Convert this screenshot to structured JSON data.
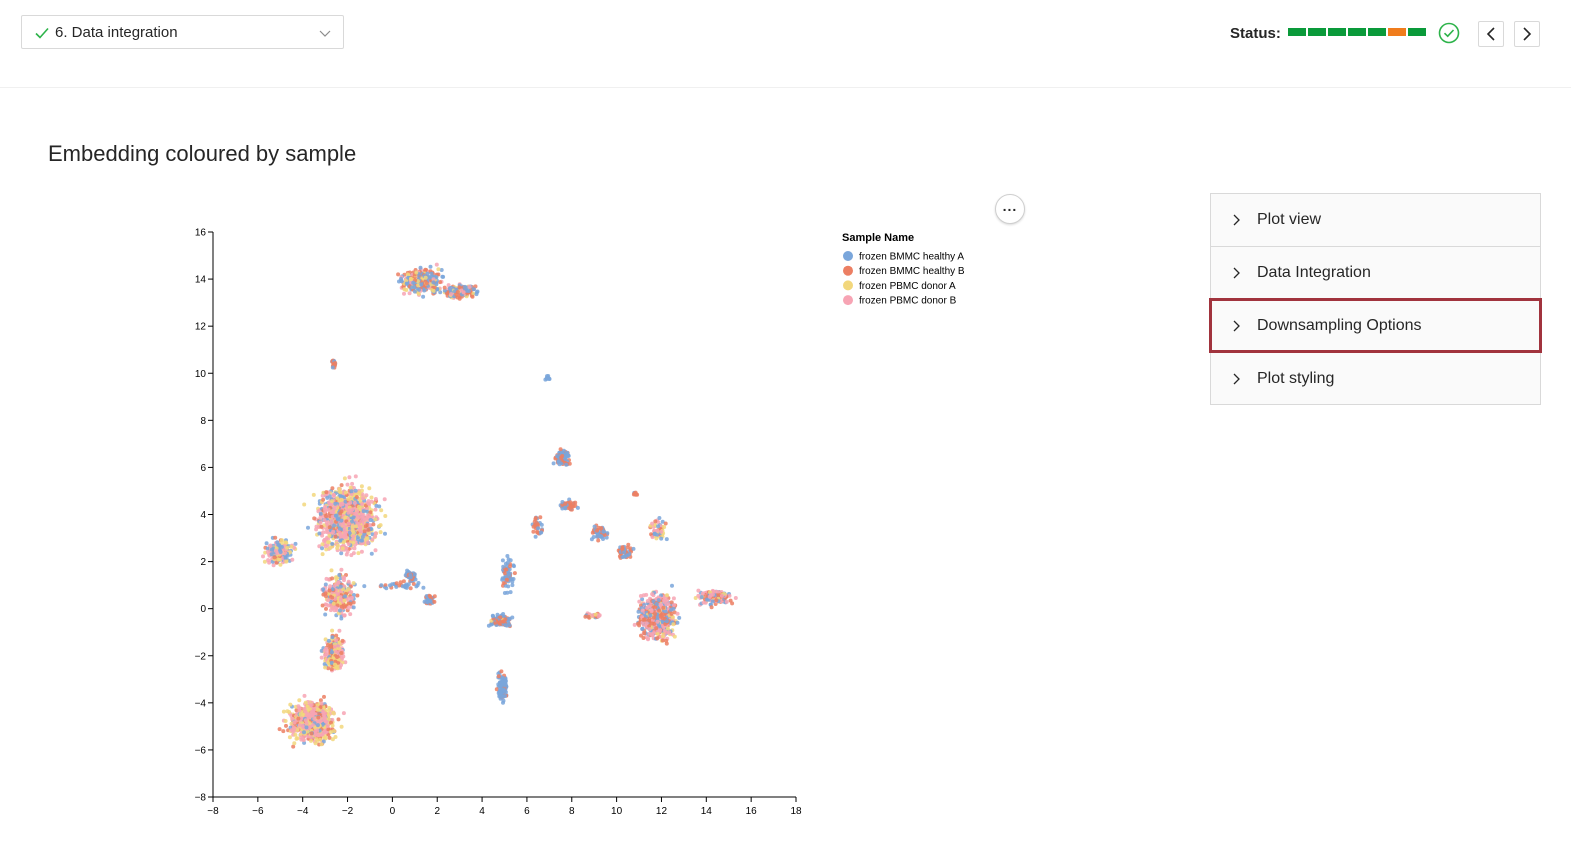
{
  "header": {
    "step_select": {
      "value": "6. Data integration"
    },
    "status": {
      "label": "Status:",
      "steps": [
        "#0a9a3a",
        "#0a9a3a",
        "#0a9a3a",
        "#0a9a3a",
        "#0a9a3a",
        "#f07c1c",
        "#0a9a3a"
      ],
      "ok_color": "#2db34a"
    }
  },
  "main": {
    "title": "Embedding coloured by sample"
  },
  "side_panel": {
    "items": [
      {
        "label": "Plot view"
      },
      {
        "label": "Data Integration"
      },
      {
        "label": "Downsampling Options",
        "highlighted": true
      },
      {
        "label": "Plot styling"
      }
    ],
    "highlight_color": "#a1333d"
  },
  "chart_data": {
    "type": "scatter",
    "title": "",
    "xlabel": "",
    "ylabel": "",
    "xlim": [
      -8,
      18
    ],
    "ylim": [
      -8,
      16
    ],
    "xticks": [
      "−8",
      "−6",
      "−4",
      "−2",
      "0",
      "2",
      "4",
      "6",
      "8",
      "10",
      "12",
      "14",
      "16",
      "18"
    ],
    "yticks": [
      "16",
      "14",
      "12",
      "10",
      "8",
      "6",
      "4",
      "2",
      "0",
      "−2",
      "−4",
      "−6",
      "−8"
    ],
    "legend": {
      "title": "Sample Name",
      "placement": "right",
      "entries": [
        {
          "name": "frozen BMMC healthy A",
          "color": "#7aa6db"
        },
        {
          "name": "frozen BMMC healthy B",
          "color": "#ec7f63"
        },
        {
          "name": "frozen PBMC donor A",
          "color": "#f2d77c"
        },
        {
          "name": "frozen PBMC donor B",
          "color": "#f7a4b4"
        }
      ]
    },
    "clusters": [
      {
        "cx": -2.0,
        "cy": 3.8,
        "rx": 2.2,
        "ry": 2.2,
        "n": 1100,
        "weights": [
          0.2,
          0.1,
          0.3,
          0.4
        ]
      },
      {
        "cx": -5.0,
        "cy": 2.4,
        "rx": 1.0,
        "ry": 0.9,
        "n": 200,
        "weights": [
          0.35,
          0.1,
          0.25,
          0.3
        ]
      },
      {
        "cx": -2.4,
        "cy": 0.6,
        "rx": 1.1,
        "ry": 1.4,
        "n": 250,
        "weights": [
          0.15,
          0.2,
          0.25,
          0.4
        ]
      },
      {
        "cx": -2.6,
        "cy": -1.9,
        "rx": 0.8,
        "ry": 1.3,
        "n": 200,
        "weights": [
          0.1,
          0.25,
          0.25,
          0.4
        ]
      },
      {
        "cx": -3.6,
        "cy": -4.8,
        "rx": 1.7,
        "ry": 1.5,
        "n": 700,
        "weights": [
          0.1,
          0.15,
          0.3,
          0.45
        ]
      },
      {
        "cx": 1.3,
        "cy": 13.9,
        "rx": 1.5,
        "ry": 0.9,
        "n": 350,
        "weights": [
          0.35,
          0.35,
          0.15,
          0.15
        ]
      },
      {
        "cx": 3.0,
        "cy": 13.5,
        "rx": 1.2,
        "ry": 0.5,
        "n": 150,
        "weights": [
          0.35,
          0.45,
          0.1,
          0.1
        ]
      },
      {
        "cx": -2.6,
        "cy": 10.4,
        "rx": 0.15,
        "ry": 0.4,
        "n": 20,
        "weights": [
          0.5,
          0.5,
          0,
          0
        ]
      },
      {
        "cx": 6.9,
        "cy": 9.8,
        "rx": 0.2,
        "ry": 0.2,
        "n": 12,
        "weights": [
          0.9,
          0.1,
          0,
          0
        ]
      },
      {
        "cx": 0.8,
        "cy": 1.4,
        "rx": 0.4,
        "ry": 0.35,
        "n": 60,
        "weights": [
          0.8,
          0.2,
          0,
          0
        ]
      },
      {
        "cx": 1.7,
        "cy": 0.4,
        "rx": 0.4,
        "ry": 0.3,
        "n": 35,
        "weights": [
          0.6,
          0.4,
          0,
          0
        ]
      },
      {
        "cx": 4.8,
        "cy": -0.5,
        "rx": 0.8,
        "ry": 0.4,
        "n": 110,
        "weights": [
          0.6,
          0.35,
          0.05,
          0
        ]
      },
      {
        "cx": 5.1,
        "cy": 1.5,
        "rx": 0.5,
        "ry": 1.2,
        "n": 70,
        "weights": [
          0.6,
          0.4,
          0,
          0
        ]
      },
      {
        "cx": 6.5,
        "cy": 3.5,
        "rx": 0.4,
        "ry": 0.8,
        "n": 35,
        "weights": [
          0.5,
          0.5,
          0,
          0
        ]
      },
      {
        "cx": 4.9,
        "cy": -3.3,
        "rx": 0.35,
        "ry": 1.0,
        "n": 110,
        "weights": [
          0.85,
          0.15,
          0,
          0
        ]
      },
      {
        "cx": 7.6,
        "cy": 6.4,
        "rx": 0.6,
        "ry": 0.6,
        "n": 80,
        "weights": [
          0.5,
          0.5,
          0,
          0
        ]
      },
      {
        "cx": 7.8,
        "cy": 4.4,
        "rx": 0.6,
        "ry": 0.3,
        "n": 50,
        "weights": [
          0.3,
          0.7,
          0,
          0
        ]
      },
      {
        "cx": 9.3,
        "cy": 3.2,
        "rx": 0.7,
        "ry": 0.6,
        "n": 55,
        "weights": [
          0.6,
          0.4,
          0,
          0
        ]
      },
      {
        "cx": 10.4,
        "cy": 2.4,
        "rx": 0.6,
        "ry": 0.5,
        "n": 45,
        "weights": [
          0.5,
          0.5,
          0,
          0
        ]
      },
      {
        "cx": 11.9,
        "cy": 3.3,
        "rx": 0.7,
        "ry": 0.8,
        "n": 50,
        "weights": [
          0.3,
          0.2,
          0.3,
          0.2
        ]
      },
      {
        "cx": 11.8,
        "cy": -0.3,
        "rx": 1.3,
        "ry": 1.6,
        "n": 600,
        "weights": [
          0.25,
          0.25,
          0.1,
          0.4
        ]
      },
      {
        "cx": 14.3,
        "cy": 0.5,
        "rx": 1.3,
        "ry": 0.5,
        "n": 150,
        "weights": [
          0.25,
          0.25,
          0.1,
          0.4
        ]
      },
      {
        "cx": 9.0,
        "cy": -0.3,
        "rx": 0.7,
        "ry": 0.15,
        "n": 30,
        "weights": [
          0.3,
          0.4,
          0.1,
          0.2
        ]
      },
      {
        "cx": 10.8,
        "cy": 4.9,
        "rx": 0.2,
        "ry": 0.2,
        "n": 10,
        "weights": [
          0.5,
          0.5,
          0,
          0
        ]
      },
      {
        "cx": 0.2,
        "cy": 1.0,
        "rx": 2.0,
        "ry": 0.3,
        "n": 30,
        "weights": [
          0.7,
          0.3,
          0,
          0
        ]
      }
    ]
  }
}
